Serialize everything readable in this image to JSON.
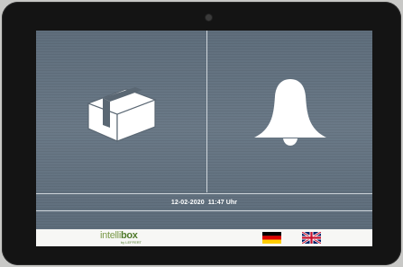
{
  "tiles": {
    "parcel": {
      "icon": "package-box-icon"
    },
    "bell": {
      "icon": "bell-icon"
    }
  },
  "status": {
    "date": "12-02-2020",
    "time": "11:47 Uhr"
  },
  "footer": {
    "logo": {
      "main": "intelli",
      "bold": "box",
      "sub": "by LEFFERT"
    },
    "languages": [
      {
        "code": "de",
        "icon": "german-flag-icon"
      },
      {
        "code": "en",
        "icon": "uk-flag-icon"
      }
    ]
  },
  "colors": {
    "screen": "#66757f",
    "divider": "#cfd6dc",
    "footer": "#f7f7f5",
    "logo": "#5f8a34"
  }
}
